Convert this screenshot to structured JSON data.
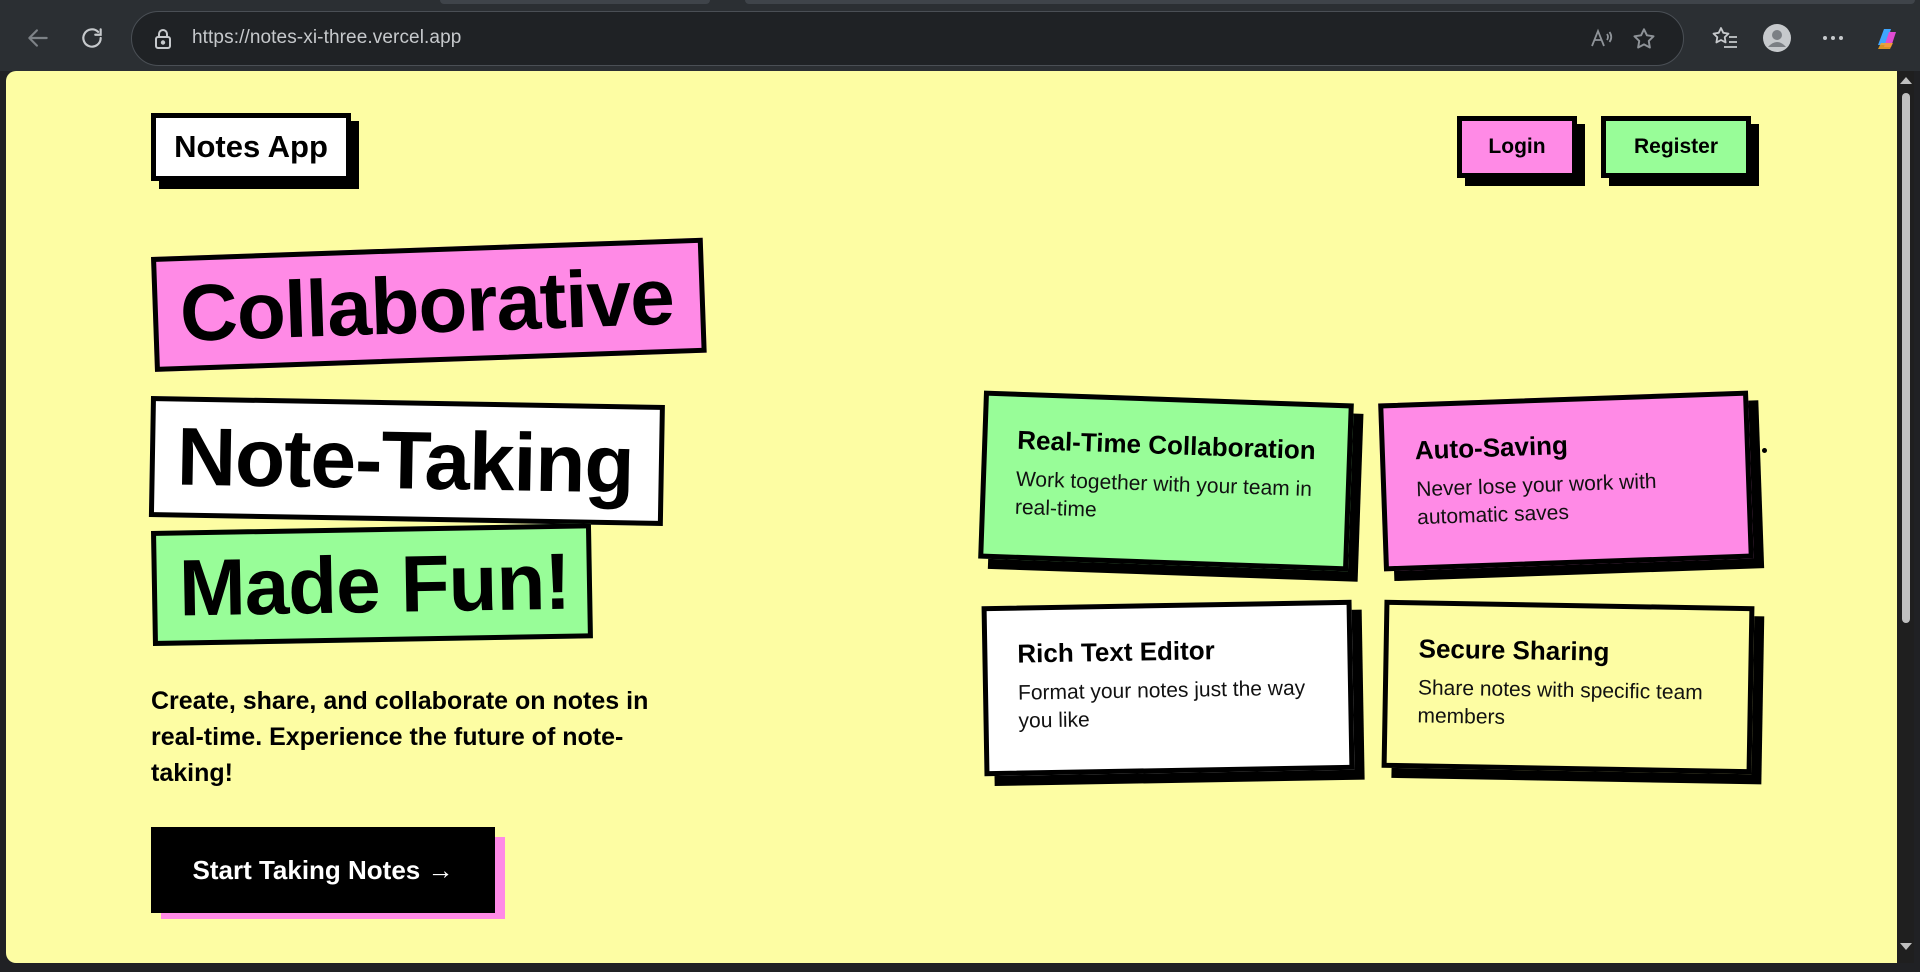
{
  "browser": {
    "url": "https://notes-xi-three.vercel.app",
    "icons": [
      "back-icon",
      "refresh-icon",
      "lock-icon",
      "read-aloud-icon",
      "favorite-star-icon",
      "favorites-icon",
      "profile-icon",
      "more-icon",
      "copilot-icon"
    ]
  },
  "header": {
    "brand": "Notes App",
    "login_label": "Login",
    "register_label": "Register"
  },
  "hero": {
    "line1": "Collaborative",
    "line2": "Note-Taking",
    "line3": "Made Fun!",
    "tagline": "Create, share, and collaborate on notes in real-time. Experience the future of note-taking!",
    "cta_label": "Start Taking Notes →"
  },
  "features": [
    {
      "title": "Real-Time Collaboration",
      "description": "Work together with your team in real-time",
      "color": "#98fd98"
    },
    {
      "title": "Auto-Saving",
      "description": "Never lose your work with automatic saves",
      "color": "#ff8ae6"
    },
    {
      "title": "Rich Text Editor",
      "description": "Format your notes just the way you like",
      "color": "#ffffff"
    },
    {
      "title": "Secure Sharing",
      "description": "Share notes with specific team members",
      "color": "#fdfda3"
    }
  ],
  "colors": {
    "page_bg": "#fdfda3",
    "pink": "#ff8ae6",
    "green": "#98fd98",
    "white": "#ffffff",
    "black": "#000000"
  }
}
